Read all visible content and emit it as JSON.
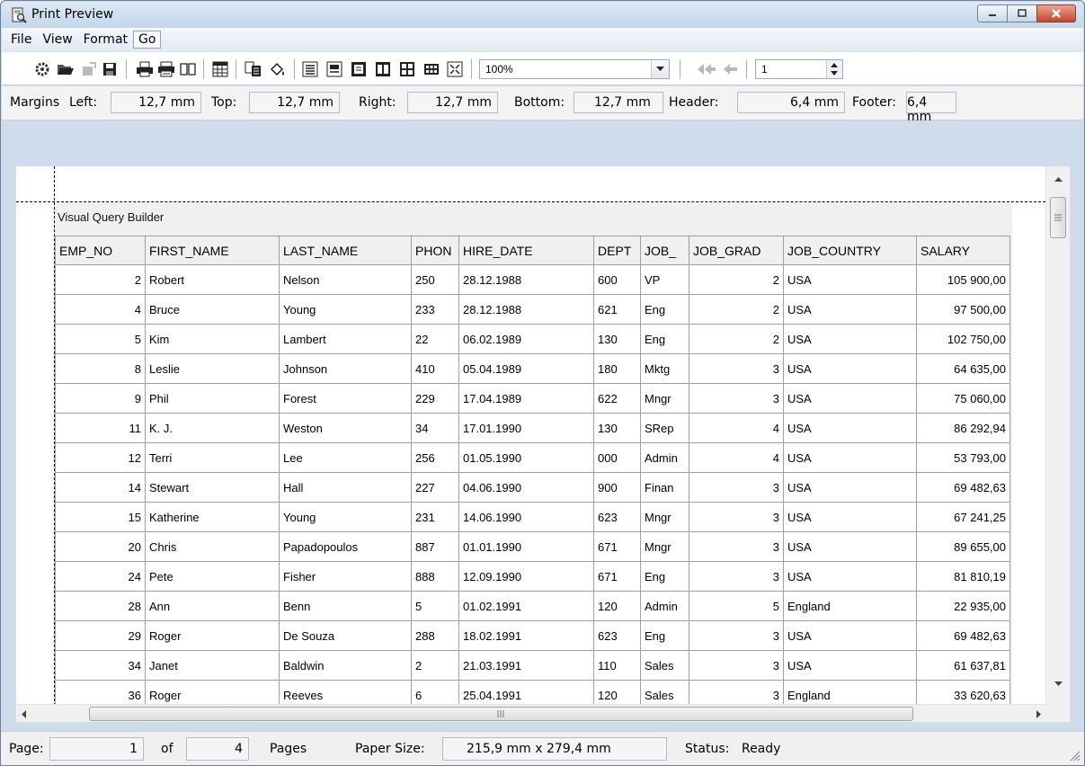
{
  "window": {
    "title": "Print Preview"
  },
  "menu": {
    "items": [
      "File",
      "View",
      "Format",
      "Go"
    ],
    "active": "Go"
  },
  "toolbar": {
    "zoom": "100%",
    "page_number": "1",
    "buttons": [
      "settings-icon",
      "open-icon",
      "export-icon",
      "save-icon",
      "print-icon",
      "print-setup-icon",
      "book-icon",
      "grid-icon",
      "copy-icon",
      "fill-icon",
      "text-icon",
      "header-icon",
      "one-page-icon",
      "two-pages-icon",
      "four-pages-icon",
      "many-pages-icon",
      "zoom-fit-icon",
      "first-page-icon",
      "previous-page-icon"
    ]
  },
  "margins": {
    "label": "Margins",
    "left_label": "Left:",
    "left": "12,7 mm",
    "top_label": "Top:",
    "top": "12,7 mm",
    "right_label": "Right:",
    "right": "12,7 mm",
    "bottom_label": "Bottom:",
    "bottom": "12,7 mm",
    "header_label": "Header:",
    "header": "6,4 mm",
    "footer_label": "Footer:",
    "footer": "6,4 mm"
  },
  "report": {
    "title": "Visual Query Builder",
    "columns": [
      "EMP_NO",
      "FIRST_NAME",
      "LAST_NAME",
      "PHON",
      "HIRE_DATE",
      "DEPT",
      "JOB_",
      "JOB_GRAD",
      "JOB_COUNTRY",
      "SALARY"
    ],
    "rows": [
      [
        "2",
        "Robert",
        "Nelson",
        "250",
        "28.12.1988",
        "600",
        "VP",
        "2",
        "USA",
        "105 900,00"
      ],
      [
        "4",
        "Bruce",
        "Young",
        "233",
        "28.12.1988",
        "621",
        "Eng",
        "2",
        "USA",
        "97 500,00"
      ],
      [
        "5",
        "Kim",
        "Lambert",
        "22",
        "06.02.1989",
        "130",
        "Eng",
        "2",
        "USA",
        "102 750,00"
      ],
      [
        "8",
        "Leslie",
        "Johnson",
        "410",
        "05.04.1989",
        "180",
        "Mktg",
        "3",
        "USA",
        "64 635,00"
      ],
      [
        "9",
        "Phil",
        "Forest",
        "229",
        "17.04.1989",
        "622",
        "Mngr",
        "3",
        "USA",
        "75 060,00"
      ],
      [
        "11",
        "K. J.",
        "Weston",
        "34",
        "17.01.1990",
        "130",
        "SRep",
        "4",
        "USA",
        "86 292,94"
      ],
      [
        "12",
        "Terri",
        "Lee",
        "256",
        "01.05.1990",
        "000",
        "Admin",
        "4",
        "USA",
        "53 793,00"
      ],
      [
        "14",
        "Stewart",
        "Hall",
        "227",
        "04.06.1990",
        "900",
        "Finan",
        "3",
        "USA",
        "69 482,63"
      ],
      [
        "15",
        "Katherine",
        "Young",
        "231",
        "14.06.1990",
        "623",
        "Mngr",
        "3",
        "USA",
        "67 241,25"
      ],
      [
        "20",
        "Chris",
        "Papadopoulos",
        "887",
        "01.01.1990",
        "671",
        "Mngr",
        "3",
        "USA",
        "89 655,00"
      ],
      [
        "24",
        "Pete",
        "Fisher",
        "888",
        "12.09.1990",
        "671",
        "Eng",
        "3",
        "USA",
        "81 810,19"
      ],
      [
        "28",
        "Ann",
        "Benn",
        "5",
        "01.02.1991",
        "120",
        "Admin",
        "5",
        "England",
        "22 935,00"
      ],
      [
        "29",
        "Roger",
        "De Souza",
        "288",
        "18.02.1991",
        "623",
        "Eng",
        "3",
        "USA",
        "69 482,63"
      ],
      [
        "34",
        "Janet",
        "Baldwin",
        "2",
        "21.03.1991",
        "110",
        "Sales",
        "3",
        "USA",
        "61 637,81"
      ],
      [
        "36",
        "Roger",
        "Reeves",
        "6",
        "25.04.1991",
        "120",
        "Sales",
        "3",
        "England",
        "33 620,63"
      ]
    ]
  },
  "status": {
    "page_label": "Page:",
    "page": "1",
    "of_label": "of",
    "total": "4",
    "pages_label": "Pages",
    "paper_label": "Paper Size:",
    "paper": "215,9 mm x 279,4 mm",
    "status_label": "Status:",
    "status": "Ready"
  }
}
